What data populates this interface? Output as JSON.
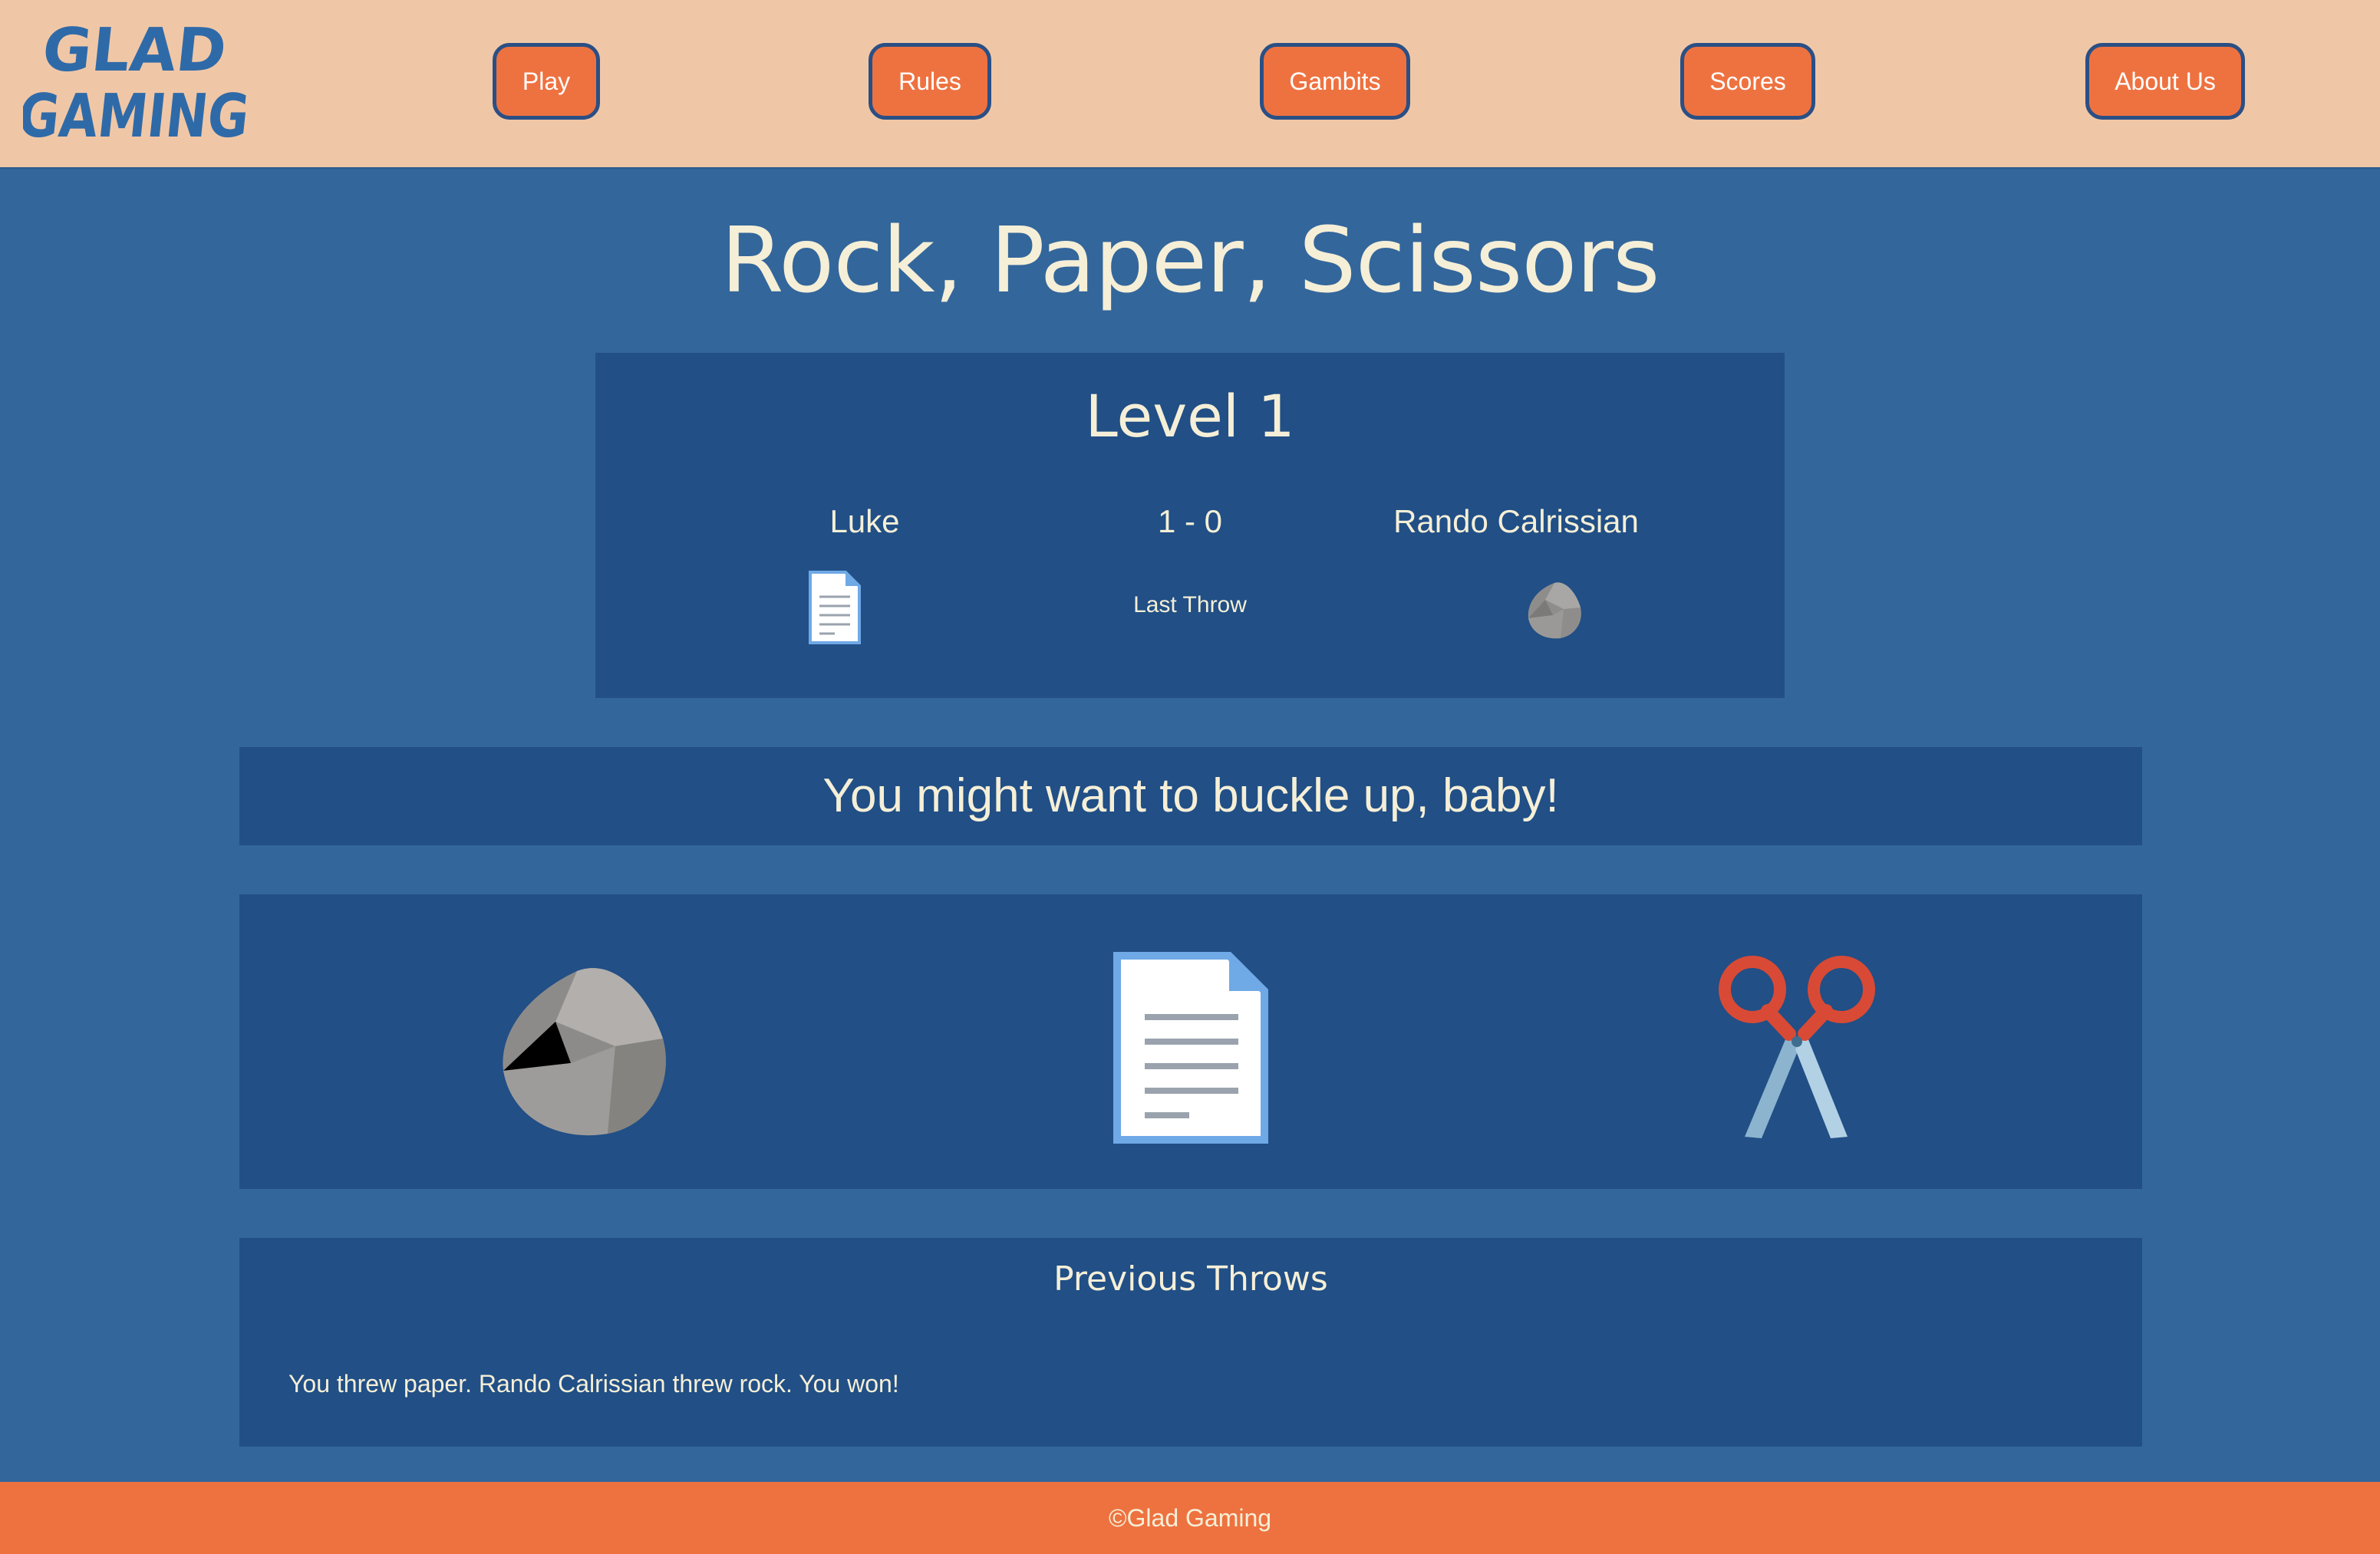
{
  "header": {
    "logo_text_line1": "GLAD",
    "logo_text_line2": "GAMING",
    "nav": {
      "play": "Play",
      "rules": "Rules",
      "gambits": "Gambits",
      "scores": "Scores",
      "about": "About Us"
    }
  },
  "main": {
    "title": "Rock, Paper, Scissors",
    "level": {
      "title": "Level 1",
      "player_name": "Luke",
      "score": "1 - 0",
      "opponent_name": "Rando Calrissian",
      "last_throw_label": "Last Throw",
      "player_throw_icon": "paper-icon",
      "opponent_throw_icon": "rock-icon"
    },
    "message": "You might want to buckle up, baby!",
    "choices": [
      "rock-icon",
      "paper-icon",
      "scissors-icon"
    ],
    "history": {
      "title": "Previous Throws",
      "items": [
        "You threw paper. Rando Calrissian threw rock. You won!"
      ]
    }
  },
  "footer": {
    "text": "©Glad Gaming"
  },
  "colors": {
    "header_bg": "#f0c7a6",
    "page_bg": "#33669b",
    "panel_bg": "#214f86",
    "accent": "#ee7240",
    "text": "#f5efd7"
  }
}
